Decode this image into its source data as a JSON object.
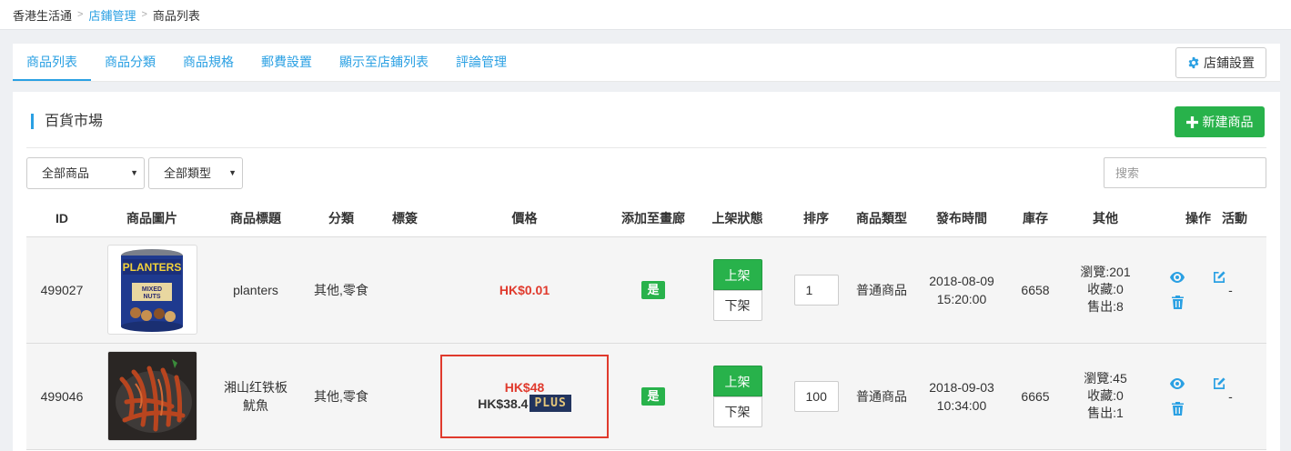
{
  "breadcrumb": {
    "home": "香港生活通",
    "section": "店鋪管理",
    "current": "商品列表"
  },
  "tabs": [
    {
      "label": "商品列表",
      "active": true
    },
    {
      "label": "商品分類",
      "active": false
    },
    {
      "label": "商品規格",
      "active": false
    },
    {
      "label": "郵費設置",
      "active": false
    },
    {
      "label": "顯示至店鋪列表",
      "active": false
    },
    {
      "label": "評論管理",
      "active": false
    }
  ],
  "shop_settings_label": "店鋪設置",
  "panel": {
    "title": "百貨市場",
    "new_button": "新建商品"
  },
  "filters": {
    "product_select": "全部商品",
    "type_select": "全部類型",
    "search_placeholder": "搜索"
  },
  "table": {
    "headers": [
      "ID",
      "商品圖片",
      "商品標題",
      "分類",
      "標簽",
      "價格",
      "添加至畫廊",
      "上架狀態",
      "排序",
      "商品類型",
      "發布時間",
      "庫存",
      "其他",
      "操作",
      "活動"
    ],
    "rows": [
      {
        "id": "499027",
        "image": "planters-mixed-nuts-can",
        "title": "planters",
        "category": "其他,零食",
        "tag": "",
        "price": "HK$0.01",
        "plus_price": "",
        "gallery": "是",
        "shelf_on": "上架",
        "shelf_off": "下架",
        "sort": "1",
        "type": "普通商品",
        "publish_date": "2018-08-09",
        "publish_time": "15:20:00",
        "stock": "6658",
        "views": "瀏覽:201",
        "favorites": "收藏:0",
        "sold": "售出:8",
        "activity": "-"
      },
      {
        "id": "499046",
        "image": "squid-tentacles-plate",
        "title_line1": "湘山红铁板",
        "title_line2": "魷魚",
        "category": "其他,零食",
        "tag": "",
        "price": "HK$48",
        "plus_price": "HK$38.4",
        "plus_label": "PLUS",
        "gallery": "是",
        "shelf_on": "上架",
        "shelf_off": "下架",
        "sort": "100",
        "type": "普通商品",
        "publish_date": "2018-09-03",
        "publish_time": "10:34:00",
        "stock": "6665",
        "views": "瀏覽:45",
        "favorites": "收藏:0",
        "sold": "售出:1",
        "activity": "-"
      }
    ]
  },
  "colors": {
    "accent": "#2aa0e3",
    "success": "#28b24b",
    "danger": "#e03a2d",
    "plus_bg": "#22345e",
    "plus_text": "#e6c77a"
  }
}
